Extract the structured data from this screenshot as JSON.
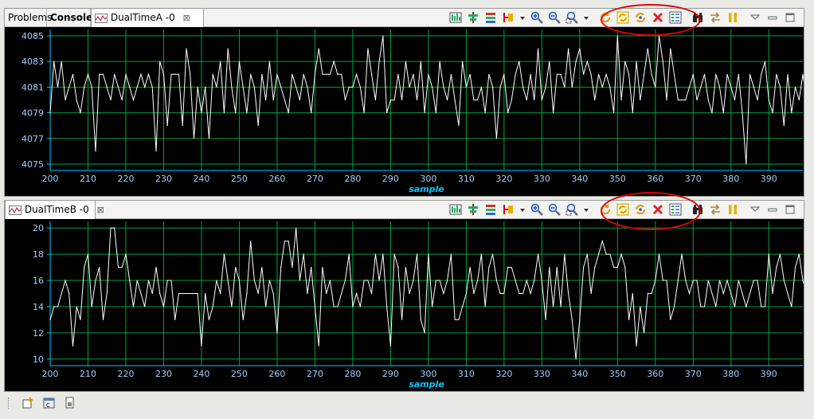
{
  "colors": {
    "plot_bg": "#000000",
    "grid": "#00a040",
    "trace": "#ffffff",
    "axis_text": "#9fd0ff",
    "axis_label": "#00c8ff",
    "highlight": "#e00000"
  },
  "tabs_top": [
    {
      "label": "Problems",
      "icon": "",
      "active": false,
      "bold": false
    },
    {
      "label": "Console",
      "icon": "",
      "active": false,
      "bold": true
    },
    {
      "label": "DualTimeA -0",
      "icon": "graph-icon",
      "active": true,
      "bold": false
    }
  ],
  "tabs_bottom": [
    {
      "label": "DualTimeB -0",
      "icon": "graph-icon",
      "active": true,
      "bold": false
    }
  ],
  "toolbar_icons": [
    "graph-properties-icon",
    "align-icon",
    "stack-icon",
    "cursor-icon",
    "dropdown-arrow-icon",
    "zoom-in-icon",
    "zoom-out-icon",
    "zoom-select-icon",
    "dropdown-arrow-icon",
    "refresh-icon",
    "auto-refresh-icon",
    "continuous-refresh-icon",
    "clear-icon",
    "legend-icon",
    "binoculars-icon",
    "arrows-icon",
    "pause-icon"
  ],
  "view_controls": [
    "view-menu-icon",
    "minimize-icon",
    "maximize-icon"
  ],
  "bottom_icons": [
    "new-view-icon",
    "code-icon",
    "file-icon"
  ],
  "chart_data": [
    {
      "type": "line",
      "xlabel": "sample",
      "xlim": [
        200,
        399
      ],
      "ylim": [
        4074.5,
        4085.5
      ],
      "x_ticks": [
        200,
        210,
        220,
        230,
        240,
        250,
        260,
        270,
        280,
        290,
        300,
        310,
        320,
        330,
        340,
        350,
        360,
        370,
        380,
        390
      ],
      "y_ticks": [
        4075,
        4077,
        4079,
        4081,
        4083,
        4085
      ],
      "grid": true,
      "x_start": 200,
      "values": [
        4079,
        4083,
        4081,
        4083,
        4080,
        4081,
        4082,
        4080,
        4079,
        4081,
        4082,
        4081,
        4076,
        4082,
        4082,
        4081,
        4080,
        4082,
        4081,
        4080,
        4082,
        4081,
        4080,
        4081,
        4082,
        4081,
        4082,
        4081,
        4076,
        4083,
        4082,
        4078,
        4082,
        4082,
        4082,
        4078,
        4084,
        4082,
        4077,
        4081,
        4079,
        4081,
        4077,
        4082,
        4081,
        4083,
        4079,
        4084,
        4081,
        4079,
        4083,
        4081,
        4079,
        4082,
        4081,
        4078,
        4082,
        4080,
        4083,
        4080,
        4082,
        4081,
        4080,
        4079,
        4082,
        4081,
        4080,
        4082,
        4081,
        4079,
        4082,
        4084,
        4082,
        4082,
        4082,
        4083,
        4082,
        4082,
        4080,
        4081,
        4081,
        4082,
        4081,
        4079,
        4084,
        4082,
        4080,
        4083,
        4085,
        4079,
        4080,
        4080,
        4082,
        4080,
        4083,
        4081,
        4082,
        4080,
        4083,
        4079,
        4082,
        4081,
        4079,
        4083,
        4081,
        4080,
        4082,
        4080,
        4078,
        4083,
        4081,
        4082,
        4080,
        4080,
        4081,
        4079,
        4082,
        4081,
        4077,
        4081,
        4082,
        4079,
        4080,
        4082,
        4083,
        4081,
        4080,
        4082,
        4080,
        4084,
        4080,
        4081,
        4083,
        4079,
        4082,
        4082,
        4081,
        4084,
        4081,
        4083,
        4084,
        4082,
        4083,
        4082,
        4080,
        4082,
        4081,
        4082,
        4081,
        4079,
        4085,
        4080,
        4083,
        4082,
        4079,
        4083,
        4080,
        4082,
        4084,
        4082,
        4081,
        4085,
        4083,
        4080,
        4084,
        4082,
        4080,
        4080,
        4080,
        4081,
        4082,
        4080,
        4081,
        4082,
        4080,
        4079,
        4082,
        4081,
        4079,
        4082,
        4081,
        4080,
        4082,
        4079,
        4075,
        4082,
        4081,
        4080,
        4082,
        4083,
        4080,
        4079,
        4082,
        4081,
        4078,
        4082,
        4079,
        4081,
        4080,
        4082,
        4080
      ],
      "highlight_region": "toolbar refresh buttons"
    },
    {
      "type": "line",
      "xlabel": "sample",
      "xlim": [
        200,
        399
      ],
      "ylim": [
        9.5,
        20.5
      ],
      "x_ticks": [
        200,
        210,
        220,
        230,
        240,
        250,
        260,
        270,
        280,
        290,
        300,
        310,
        320,
        330,
        340,
        350,
        360,
        370,
        380,
        390
      ],
      "y_ticks": [
        10,
        12,
        14,
        16,
        18,
        20
      ],
      "grid": true,
      "x_start": 200,
      "values": [
        13,
        14,
        14,
        15,
        16,
        15,
        11,
        14,
        13,
        17,
        18,
        14,
        16,
        17,
        13,
        15,
        20,
        20,
        17,
        17,
        18,
        16,
        14,
        16,
        15,
        14,
        16,
        15,
        17,
        15,
        14,
        16,
        16,
        13,
        15,
        15,
        15,
        15,
        15,
        15,
        11,
        15,
        13,
        14,
        16,
        15,
        18,
        16,
        14,
        17,
        16,
        13,
        15,
        19,
        16,
        15,
        17,
        14,
        16,
        15,
        12,
        17,
        19,
        19,
        17,
        20,
        16,
        18,
        15,
        17,
        14,
        11,
        17,
        15,
        16,
        14,
        14,
        15,
        16,
        18,
        14,
        15,
        14,
        16,
        16,
        15,
        18,
        16,
        18,
        14,
        11,
        18,
        17,
        13,
        17,
        15,
        16,
        18,
        13,
        12,
        18,
        14,
        16,
        16,
        15,
        16,
        18,
        13,
        13,
        14,
        15,
        17,
        15,
        16,
        18,
        14,
        17,
        18,
        16,
        15,
        15,
        17,
        17,
        16,
        15,
        15,
        16,
        15,
        16,
        18,
        16,
        13,
        17,
        14,
        17,
        14,
        18,
        15,
        13,
        10,
        13,
        17,
        18,
        15,
        17,
        18,
        19,
        18,
        18,
        17,
        17,
        18,
        17,
        13,
        15,
        11,
        14,
        12,
        15,
        15,
        16,
        18,
        16,
        16,
        13,
        14,
        16,
        18,
        16,
        15,
        16,
        16,
        14,
        14,
        16,
        15,
        14,
        16,
        15,
        16,
        15,
        14,
        16,
        15,
        14,
        15,
        16,
        16,
        14,
        14,
        18,
        15,
        17,
        18,
        16,
        15,
        14,
        17,
        18,
        16,
        15
      ],
      "highlight_region": "toolbar refresh buttons"
    }
  ]
}
